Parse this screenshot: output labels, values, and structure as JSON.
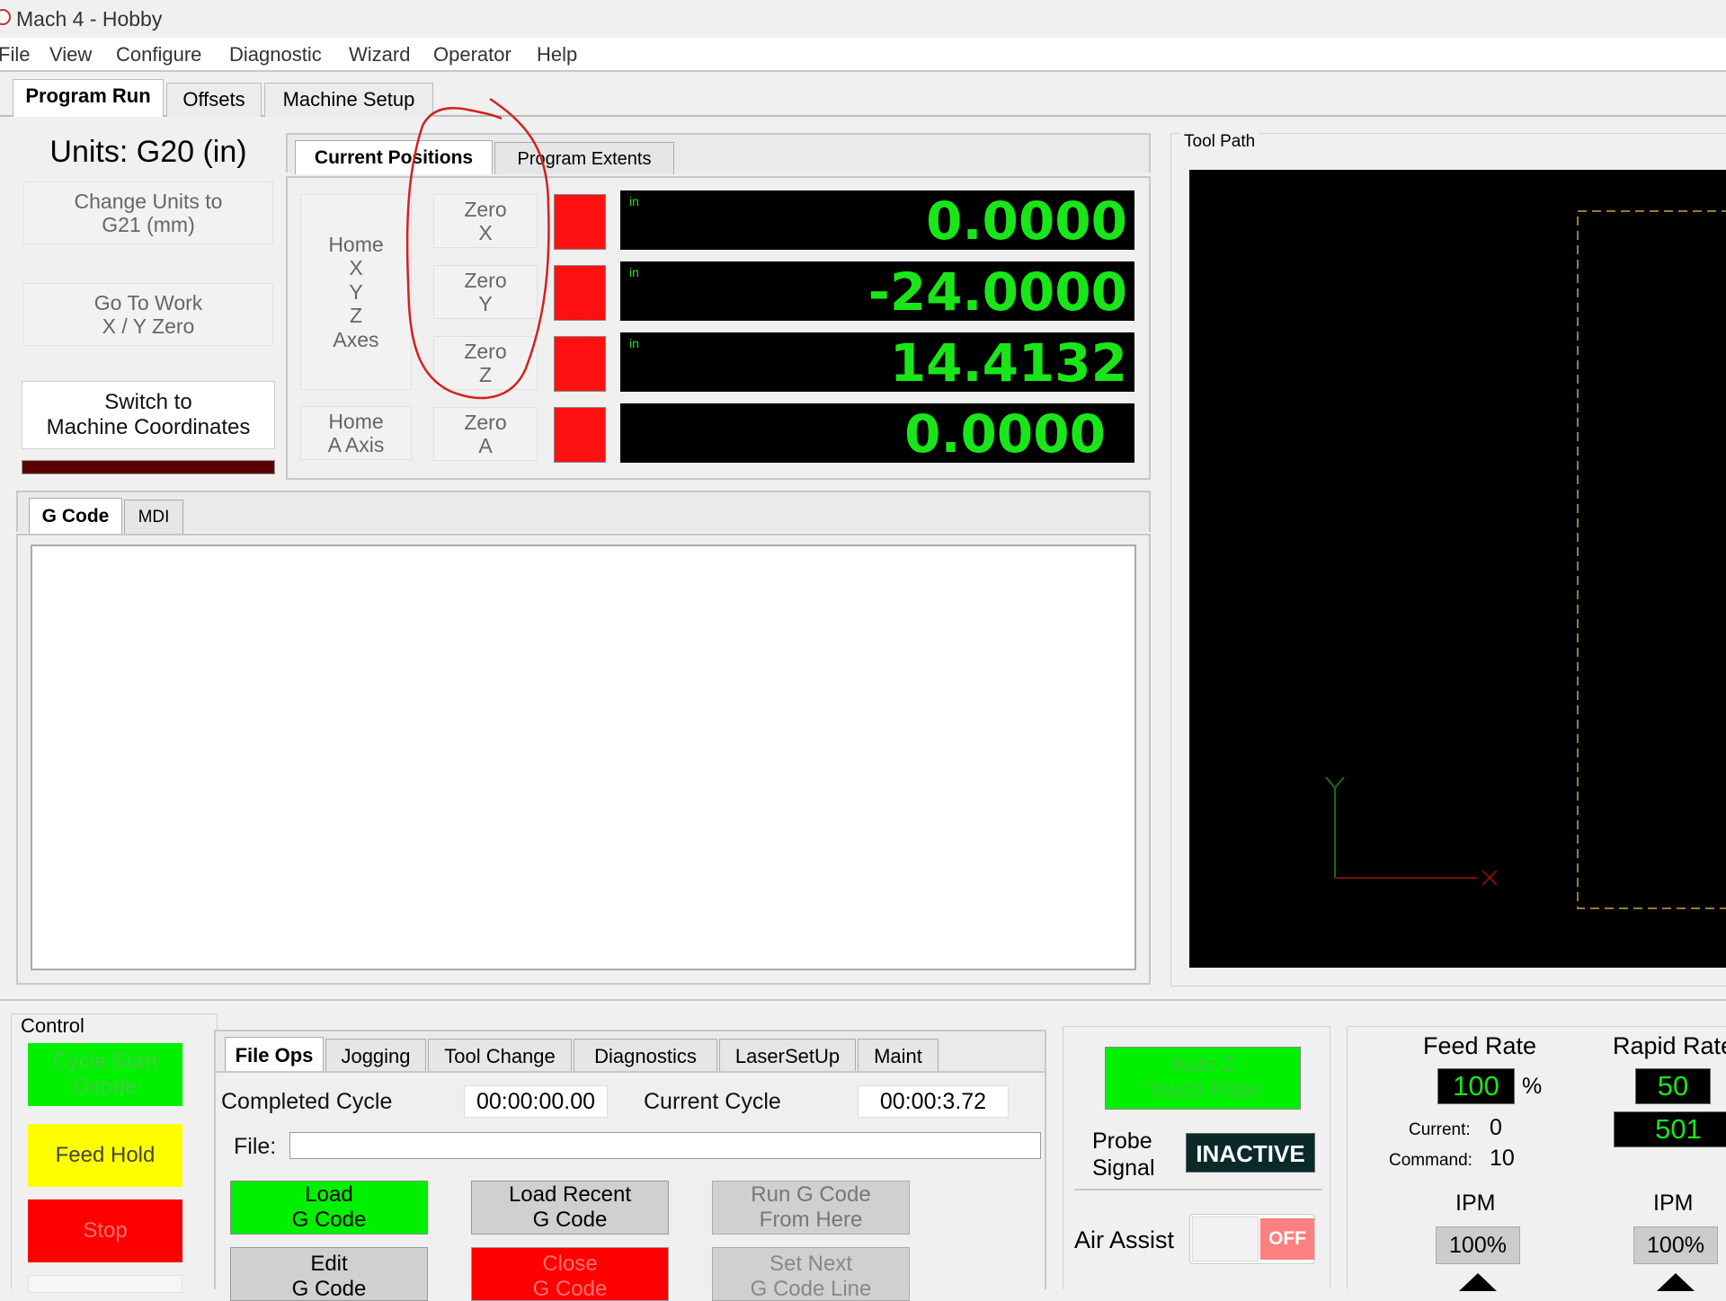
{
  "window": {
    "title": "Mach 4 - Hobby"
  },
  "menu": [
    "File",
    "View",
    "Configure",
    "Diagnostic",
    "Wizard",
    "Operator",
    "Help"
  ],
  "main_tabs": [
    "Program Run",
    "Offsets",
    "Machine Setup"
  ],
  "units_panel": {
    "units_label": "Units: G20 (in)",
    "change_units": "Change Units to\nG21 (mm)",
    "goto_work": "Go To Work\nX / Y Zero",
    "switch_coords": "Switch to\nMachine Coordinates"
  },
  "dro_tabs": [
    "Current Positions",
    "Program Extents"
  ],
  "dro": {
    "home_xyz": "Home\nX\nY\nZ\nAxes",
    "home_a": "Home\nA Axis",
    "zero_buttons": [
      "Zero\nX",
      "Zero\nY",
      "Zero\nZ",
      "Zero\nA"
    ],
    "axes": [
      {
        "unit": "in",
        "value": "0.0000"
      },
      {
        "unit": "in",
        "value": "-24.0000"
      },
      {
        "unit": "in",
        "value": "14.4132"
      },
      {
        "unit": "",
        "value": "0.0000"
      }
    ]
  },
  "toolpath": {
    "title": "Tool Path"
  },
  "gcode_tabs": [
    "G Code",
    "MDI"
  ],
  "control": {
    "title": "Control",
    "cycle_start": "Cycle Start\nGcode",
    "feed_hold": "Feed Hold",
    "stop": "Stop"
  },
  "bottom_tabs": [
    "File Ops",
    "Jogging",
    "Tool Change",
    "Diagnostics",
    "LaserSetUp",
    "Maint"
  ],
  "file_ops": {
    "completed_cycle_label": "Completed Cycle",
    "completed_cycle_value": "00:00:00.00",
    "current_cycle_label": "Current Cycle",
    "current_cycle_value": "00:00:3.72",
    "file_label": "File:",
    "file_value": "",
    "load_gcode": "Load\nG Code",
    "load_recent": "Load Recent\nG Code",
    "run_from_here": "Run G Code\nFrom Here",
    "edit_gcode": "Edit\nG Code",
    "close_gcode": "Close\nG Code",
    "set_next_line": "Set Next\nG Code Line"
  },
  "probe": {
    "auto_z": "Auto Z\nTouch Plate",
    "probe_label": "Probe\nSignal",
    "probe_status": "INACTIVE",
    "air_assist_label": "Air Assist",
    "air_assist_state": "OFF"
  },
  "feed": {
    "feed_rate_label": "Feed Rate",
    "feed_rate_value": "100",
    "feed_pct_sign": "%",
    "current_label": "Current:",
    "current_value": "0",
    "command_label": "Command:",
    "command_value": "10",
    "ipm_label": "IPM",
    "override": "100%",
    "rapid_label": "Rapid Rate",
    "rapid_value": "50",
    "rapid_ipm_value": "501",
    "rapid_ipm_label": "IPM",
    "rapid_override": "100%"
  },
  "colors": {
    "dro_green": "#19e619",
    "led_red": "#ff1010",
    "cycle_green": "#00f000",
    "hold_yellow": "#ffff00",
    "stop_red": "#ff0000",
    "annotation_red": "#d42020"
  }
}
